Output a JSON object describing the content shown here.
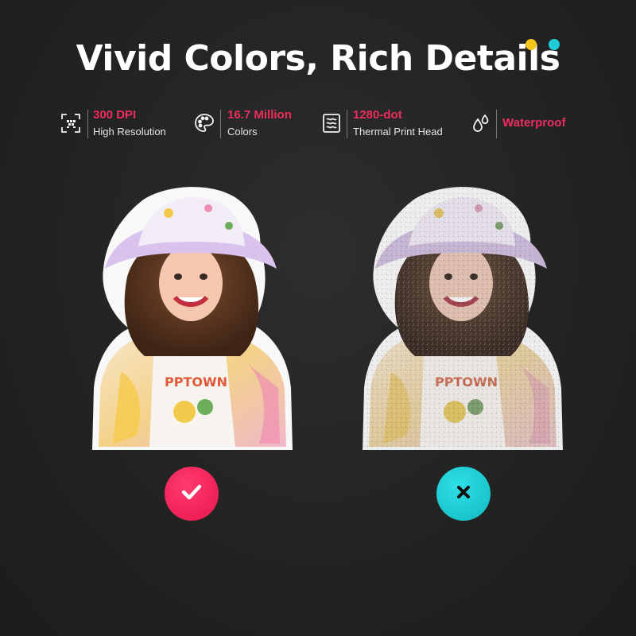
{
  "headline": "Vivid Colors, Rich Details",
  "accent_colors": {
    "yellow": "#f5c518",
    "cyan": "#1ecad3",
    "pink": "#ef2d5e"
  },
  "features": [
    {
      "icon": "scan-resolution-icon",
      "value": "300 DPI",
      "label": "High Resolution"
    },
    {
      "icon": "palette-icon",
      "value": "16.7 Million",
      "label": "Colors"
    },
    {
      "icon": "print-head-icon",
      "value": "1280-dot",
      "label": "Thermal Print Head"
    },
    {
      "icon": "water-drops-icon",
      "value": "Waterproof",
      "label": ""
    }
  ],
  "comparison": {
    "good": {
      "image": "vivid-photo",
      "mark": "check-icon",
      "color": "#ef2d5e"
    },
    "bad": {
      "image": "grainy-photo",
      "mark": "cross-icon",
      "color": "#1ecad3"
    }
  }
}
